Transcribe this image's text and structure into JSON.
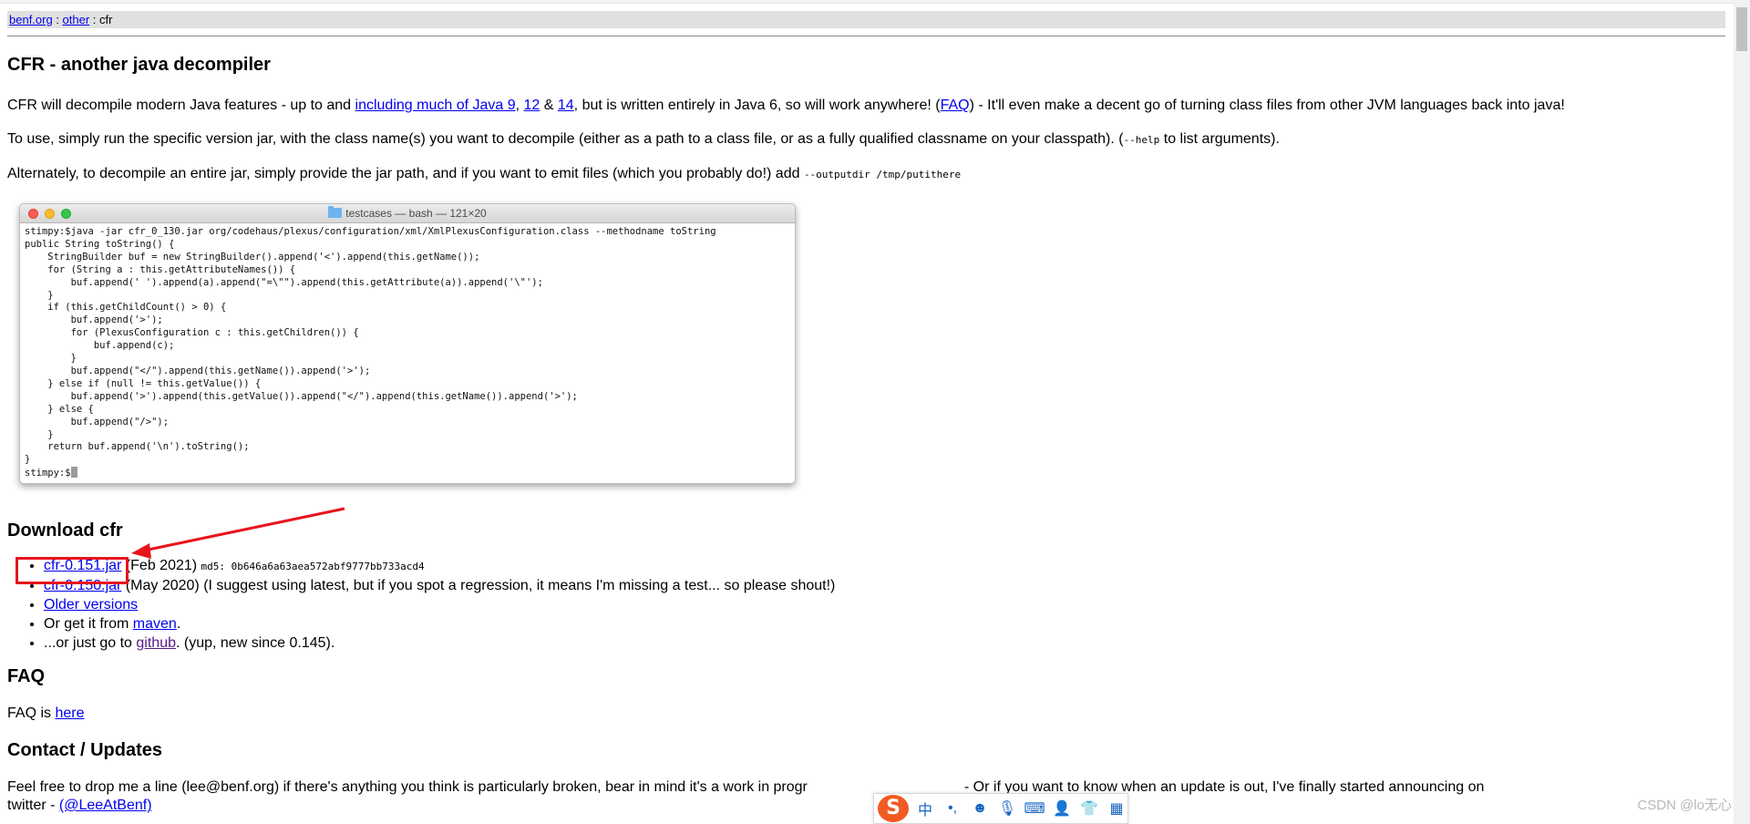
{
  "breadcrumb": {
    "root": "benf.org",
    "sep1": " : ",
    "mid": "other",
    "sep2": " : ",
    "current": "cfr"
  },
  "header": {
    "title": "CFR - another java decompiler"
  },
  "intro": {
    "p1_pre": "CFR will decompile modern Java features - up to and ",
    "p1_link1": "including much of Java 9",
    "p1_sep1": ", ",
    "p1_link2": "12",
    "p1_sep2": " & ",
    "p1_link3": "14",
    "p1_mid": ", but is written entirely in Java 6, so will work anywhere! (",
    "p1_faq": "FAQ",
    "p1_post": ") - It'll even make a decent go of turning class files from other JVM languages back into java!",
    "p2_pre": "To use, simply run the specific version jar, with the class name(s) you want to decompile (either as a path to a class file, or as a fully qualified classname on your classpath). (",
    "p2_code": "--help",
    "p2_post": " to list arguments).",
    "p3_pre": "Alternately, to decompile an entire jar, simply provide the jar path, and if you want to emit files (which you probably do!) add ",
    "p3_code": "--outputdir /tmp/putithere"
  },
  "terminal": {
    "title": "testcases — bash — 121×20",
    "lines": "stimpy:$java -jar cfr_0_130.jar org/codehaus/plexus/configuration/xml/XmlPlexusConfiguration.class --methodname toString\npublic String toString() {\n    StringBuilder buf = new StringBuilder().append('<').append(this.getName());\n    for (String a : this.getAttributeNames()) {\n        buf.append(' ').append(a).append(\"=\\\"\").append(this.getAttribute(a)).append('\\\"');\n    }\n    if (this.getChildCount() > 0) {\n        buf.append('>');\n        for (PlexusConfiguration c : this.getChildren()) {\n            buf.append(c);\n        }\n        buf.append(\"</\").append(this.getName()).append('>');\n    } else if (null != this.getValue()) {\n        buf.append('>').append(this.getValue()).append(\"</\").append(this.getName()).append('>');\n    } else {\n        buf.append(\"/>\");\n    }\n    return buf.append('\\n').toString();\n}",
    "prompt": "stimpy:$"
  },
  "download": {
    "title": "Download cfr",
    "item1_link": "cfr-0.151.jar",
    "item1_date": " (Feb 2021) ",
    "item1_md5": "md5: 0b646a6a63aea572abf9777bb733acd4",
    "item2_link": "cfr-0.150.jar",
    "item2_text": " (May 2020) (I suggest using latest, but if you spot a regression, it means I'm missing a test... so please shout!)",
    "item3_link": "Older versions",
    "item4_pre": "Or get it from ",
    "item4_link": "maven",
    "item4_post": ".",
    "item5_pre": "...or just go to ",
    "item5_link": "github",
    "item5_post": ". (yup, new since 0.145)."
  },
  "faq": {
    "title": "FAQ",
    "pre": "FAQ is ",
    "link": "here"
  },
  "contact": {
    "title": "Contact / Updates",
    "text_pre": "Feel free to drop me a line (lee@benf.org) if there's anything you think is particularly broken, bear in mind it's a work in progr",
    "text_post": "- Or if you want to know when an update is out, I've finally started announcing on",
    "line2_pre": "twitter - ",
    "line2_link": "(@LeeAtBenf)"
  },
  "ime": {
    "logo": "S",
    "lang": "中",
    "punct": "•,",
    "emoji": "☻",
    "mic": "🎙",
    "keyboard": "⌨",
    "user": "👤",
    "shirt": "👕",
    "apps": "▦"
  },
  "watermark": "CSDN @lo无心",
  "colors": {
    "link": "#0000ee",
    "visited": "#551a8b",
    "annotation": "#e8141c",
    "breadcrumb_bg": "#e0e0e0"
  }
}
